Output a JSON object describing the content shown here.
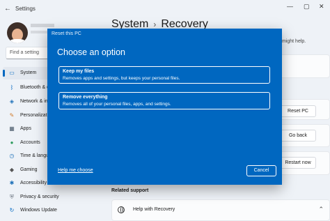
{
  "app": {
    "title": "Settings",
    "back_icon": "back-arrow-icon",
    "window_controls": [
      "minimize-icon",
      "maximize-icon",
      "close-icon"
    ]
  },
  "search": {
    "placeholder": "Find a setting"
  },
  "sidebar": {
    "items": [
      {
        "label": "System",
        "icon": "system-icon",
        "active": true
      },
      {
        "label": "Bluetooth & devices",
        "icon": "bluetooth-icon"
      },
      {
        "label": "Network & internet",
        "icon": "wifi-icon"
      },
      {
        "label": "Personalization",
        "icon": "brush-icon"
      },
      {
        "label": "Apps",
        "icon": "apps-icon"
      },
      {
        "label": "Accounts",
        "icon": "person-icon"
      },
      {
        "label": "Time & language",
        "icon": "globe-clock-icon"
      },
      {
        "label": "Gaming",
        "icon": "gamepad-icon"
      },
      {
        "label": "Accessibility",
        "icon": "accessibility-icon"
      },
      {
        "label": "Privacy & security",
        "icon": "shield-icon"
      },
      {
        "label": "Windows Update",
        "icon": "update-icon"
      }
    ]
  },
  "main": {
    "breadcrumb": {
      "parent": "System",
      "separator": "›",
      "current": "Recovery"
    },
    "help_text": "might help.",
    "buttons": {
      "reset_pc": "Reset PC",
      "go_back": "Go back",
      "restart_now": "Restart now"
    },
    "related_support": "Related support",
    "help_with_recovery": "Help with Recovery"
  },
  "dialog": {
    "window_title": "Reset this PC",
    "heading": "Choose an option",
    "options": [
      {
        "title": "Keep my files",
        "description": "Removes apps and settings, but keeps your personal files."
      },
      {
        "title": "Remove everything",
        "description": "Removes all of your personal files, apps, and settings."
      }
    ],
    "help_link": "Help me choose",
    "cancel": "Cancel",
    "accent": "#0067c0"
  }
}
